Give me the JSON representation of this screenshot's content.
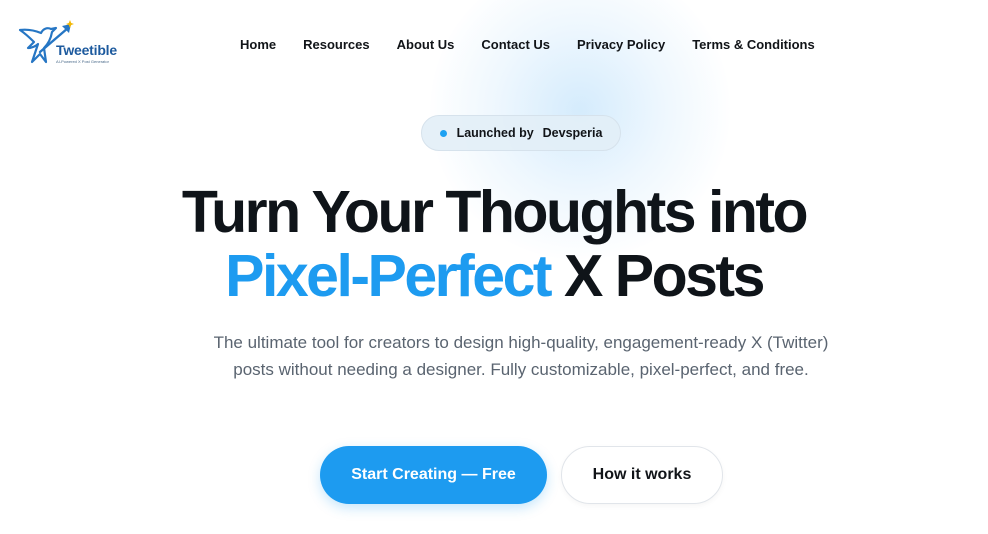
{
  "brand": {
    "name": "Tweetible",
    "tagline": "AI-Powered X Post Generator",
    "accent_color": "#1d9bf0",
    "logo_icon": "bird-arrow-logo-icon"
  },
  "nav": {
    "items": [
      {
        "label": "Home"
      },
      {
        "label": "Resources"
      },
      {
        "label": "About Us"
      },
      {
        "label": "Contact Us"
      },
      {
        "label": "Privacy Policy"
      },
      {
        "label": "Terms & Conditions"
      }
    ]
  },
  "badge": {
    "prefix": "Launched by",
    "name": "Devsperia",
    "dot_color": "#1da1f2"
  },
  "hero": {
    "line1": "Turn Your Thoughts into",
    "line2_accent": "Pixel-Perfect",
    "line2_rest": " X Posts",
    "subtitle": "The ultimate tool for creators to design high-quality, engagement-ready X (Twitter) posts without needing a designer. Fully customizable, pixel-perfect, and free."
  },
  "cta": {
    "primary_label": "Start Creating — Free",
    "secondary_label": "How it works"
  }
}
